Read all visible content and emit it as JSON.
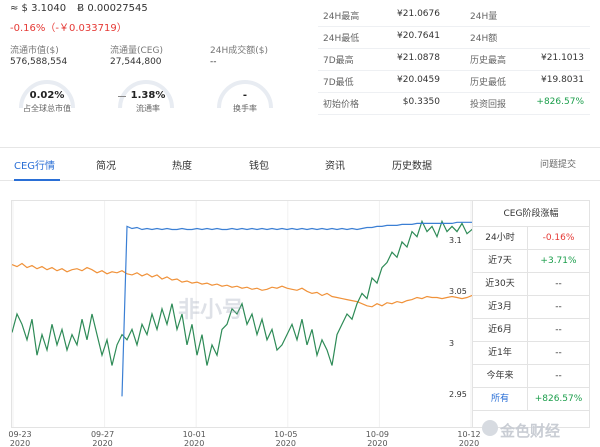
{
  "header": {
    "price_usd": "≈ $ 3.1040",
    "price_btc": "Ƀ 0.00027545",
    "change": "-0.16%（-￥0.033719）"
  },
  "stats": [
    {
      "label": "流通市值($)",
      "value": "576,588,554"
    },
    {
      "label": "流通量(CEG)",
      "value": "27,544,800"
    },
    {
      "label": "24H成交额($)",
      "value": "--"
    }
  ],
  "rings": [
    {
      "value": "0.02%",
      "caption": "占全球总市值"
    },
    {
      "value": "1.38%",
      "caption": "流通率"
    },
    {
      "value": "-",
      "caption": "换手率"
    }
  ],
  "market_stats": [
    {
      "label": "24H最高",
      "value": "¥21.0676",
      "label2": "24H量",
      "value2": ""
    },
    {
      "label": "24H最低",
      "value": "¥20.7641",
      "label2": "24H额",
      "value2": ""
    },
    {
      "label": "7D最高",
      "value": "¥21.0878",
      "label2": "历史最高",
      "value2": "¥21.1013"
    },
    {
      "label": "7D最低",
      "value": "¥20.0459",
      "label2": "历史最低",
      "value2": "¥19.8031"
    },
    {
      "label": "初始价格",
      "value": "$0.3350",
      "label2": "投资回报",
      "value2": "+826.57%"
    }
  ],
  "tabs": [
    "CEG行情",
    "简况",
    "热度",
    "钱包",
    "资讯",
    "历史数据"
  ],
  "feedback_link": "问题提交",
  "period_table": {
    "title": "CEG阶段涨幅",
    "rows": [
      {
        "label": "24小时",
        "value": "-0.16%"
      },
      {
        "label": "近7天",
        "value": "+3.71%"
      },
      {
        "label": "近30天",
        "value": "--"
      },
      {
        "label": "近3月",
        "value": "--"
      },
      {
        "label": "近6月",
        "value": "--"
      },
      {
        "label": "近1年",
        "value": "--"
      },
      {
        "label": "今年来",
        "value": "--"
      },
      {
        "label": "所有",
        "value": "+826.57%"
      }
    ]
  },
  "watermark": "非小号",
  "brand": "金色财经",
  "colors": {
    "accent": "#2a6fd6",
    "negative": "#e53935",
    "positive": "#1b9e4b",
    "line_blue": "#3b7fd4",
    "line_orange": "#f0923a",
    "line_green": "#2e8b57"
  },
  "chart_data": {
    "type": "line",
    "x_ticks": [
      "09-23\n2020",
      "09-27\n2020",
      "10-01\n2020",
      "10-05\n2020",
      "10-09\n2020",
      "10-12\n2020"
    ],
    "y_ticks": [
      "3.1",
      "3.05",
      "3",
      "2.95"
    ],
    "ylim": [
      2.93,
      3.13
    ],
    "series": [
      {
        "name": "",
        "color": "#3b7fd4",
        "values": [
          null,
          null,
          null,
          null,
          null,
          null,
          null,
          null,
          null,
          null,
          null,
          null,
          null,
          null,
          null,
          null,
          null,
          null,
          null,
          null,
          null,
          null,
          2.95,
          3.115,
          3.113,
          3.114,
          3.112,
          3.113,
          3.112,
          3.113,
          3.112,
          3.113,
          3.112,
          3.112,
          3.113,
          3.112,
          3.112,
          3.113,
          3.112,
          3.113,
          3.112,
          3.113,
          3.112,
          3.112,
          3.113,
          3.112,
          3.113,
          3.112,
          3.113,
          3.112,
          3.113,
          3.112,
          3.113,
          3.112,
          3.113,
          3.112,
          3.113,
          3.112,
          3.113,
          3.112,
          3.113,
          3.112,
          3.113,
          3.112,
          3.113,
          3.112,
          3.113,
          3.112,
          3.113,
          3.112,
          3.113,
          3.114,
          3.114,
          3.115,
          3.115,
          3.116,
          3.116,
          3.116,
          3.117,
          3.117,
          3.117,
          3.118,
          3.118,
          3.118,
          3.118,
          3.118,
          3.118,
          3.118,
          3.118,
          3.119,
          3.119,
          3.119,
          3.119
        ]
      },
      {
        "name": "",
        "color": "#f0923a",
        "values": [
          3.078,
          3.076,
          3.079,
          3.075,
          3.077,
          3.074,
          3.076,
          3.073,
          3.075,
          3.072,
          3.074,
          3.071,
          3.073,
          3.074,
          3.072,
          3.075,
          3.073,
          3.07,
          3.072,
          3.069,
          3.071,
          3.07,
          3.072,
          3.069,
          3.068,
          3.07,
          3.067,
          3.069,
          3.066,
          3.068,
          3.064,
          3.066,
          3.063,
          3.064,
          3.061,
          3.062,
          3.06,
          3.061,
          3.059,
          3.06,
          3.058,
          3.059,
          3.057,
          3.058,
          3.056,
          3.057,
          3.055,
          3.056,
          3.054,
          3.055,
          3.053,
          3.054,
          3.056,
          3.055,
          3.057,
          3.055,
          3.054,
          3.053,
          3.055,
          3.052,
          3.05,
          3.051,
          3.048,
          3.05,
          3.047,
          3.046,
          3.045,
          3.044,
          3.043,
          3.042,
          3.04,
          3.038,
          3.037,
          3.04,
          3.038,
          3.041,
          3.04,
          3.042,
          3.041,
          3.043,
          3.044,
          3.046,
          3.045,
          3.047,
          3.046,
          3.046,
          3.045,
          3.046,
          3.047,
          3.046,
          3.045,
          3.046,
          3.048,
          3.047
        ]
      },
      {
        "name": "",
        "color": "#2e8b57",
        "values": [
          3.012,
          3.03,
          3.02,
          3.005,
          3.025,
          2.99,
          3.01,
          2.995,
          3.02,
          3.0,
          3.015,
          2.995,
          3.01,
          3.0,
          3.025,
          3.005,
          3.03,
          3.01,
          2.99,
          3.005,
          2.98,
          3.0,
          3.01,
          3.005,
          3.015,
          3.0,
          3.02,
          3.01,
          3.03,
          3.015,
          3.035,
          3.02,
          3.04,
          3.015,
          3.03,
          3.0,
          3.02,
          2.99,
          3.01,
          2.98,
          3.0,
          2.99,
          3.015,
          3.02,
          3.035,
          3.03,
          3.04,
          3.02,
          3.03,
          3.01,
          3.025,
          3.005,
          3.015,
          2.995,
          3.0,
          3.01,
          3.02,
          3.005,
          3.025,
          3.0,
          3.015,
          2.99,
          3.005,
          2.995,
          2.98,
          3.01,
          3.02,
          3.03,
          3.025,
          3.04,
          3.05,
          3.045,
          3.065,
          3.06,
          3.075,
          3.08,
          3.09,
          3.085,
          3.1,
          3.095,
          3.11,
          3.105,
          3.12,
          3.11,
          3.115,
          3.105,
          3.12,
          3.11,
          3.115,
          3.11,
          3.118,
          3.108,
          3.112,
          3.105
        ]
      }
    ]
  }
}
